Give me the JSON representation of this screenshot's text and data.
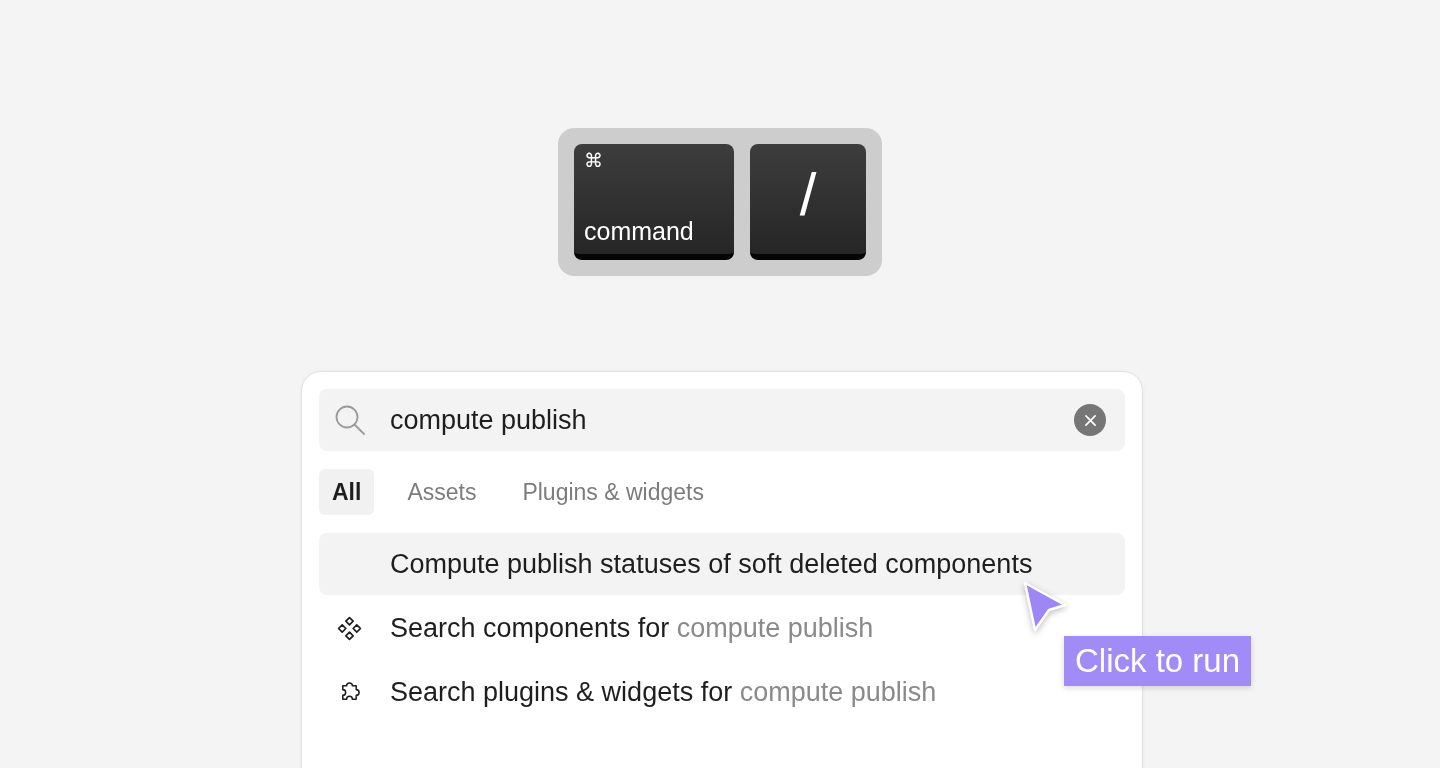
{
  "keyboard_shortcut": {
    "keys": [
      {
        "kind": "modifier",
        "symbol": "⌘",
        "label": "command"
      },
      {
        "kind": "character",
        "label": "/"
      }
    ]
  },
  "command_palette": {
    "search": {
      "value": "compute publish"
    },
    "tabs": [
      {
        "label": "All",
        "selected": true
      },
      {
        "label": "Assets",
        "selected": false
      },
      {
        "label": "Plugins & widgets",
        "selected": false
      }
    ],
    "results": [
      {
        "kind": "action",
        "label": "Compute publish statuses of soft deleted components",
        "selected": true
      },
      {
        "kind": "components",
        "label": "Search components for",
        "query": "compute publish",
        "selected": false
      },
      {
        "kind": "plugins",
        "label": "Search plugins & widgets for",
        "query": "compute publish",
        "selected": false
      }
    ]
  },
  "tooltip": {
    "text": "Click to run"
  }
}
